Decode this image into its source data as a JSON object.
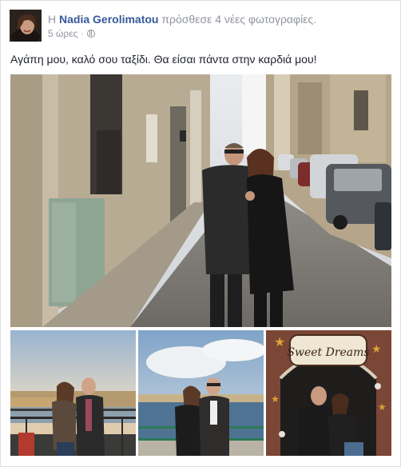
{
  "post": {
    "article": "Η",
    "author": "Nadia Gerolimatou",
    "action": "πρόσθεσε 4 νέες φωτογραφίες.",
    "time": "5 ώρες",
    "privacy_icon": "globe-icon",
    "caption": "Αγάπη μου, καλό σου ταξίδι. Θα είσαι πάντα στην καρδιά μου!"
  },
  "photos": {
    "main": "street-photo",
    "small": [
      "harbor-sunset-photo",
      "seaside-photo",
      "sweet-dreams-photo"
    ],
    "sign_text": "Sweet Dreams"
  },
  "colors": {
    "link": "#365899",
    "meta": "#90949c",
    "text": "#1d2129",
    "border": "#dddfe2"
  }
}
